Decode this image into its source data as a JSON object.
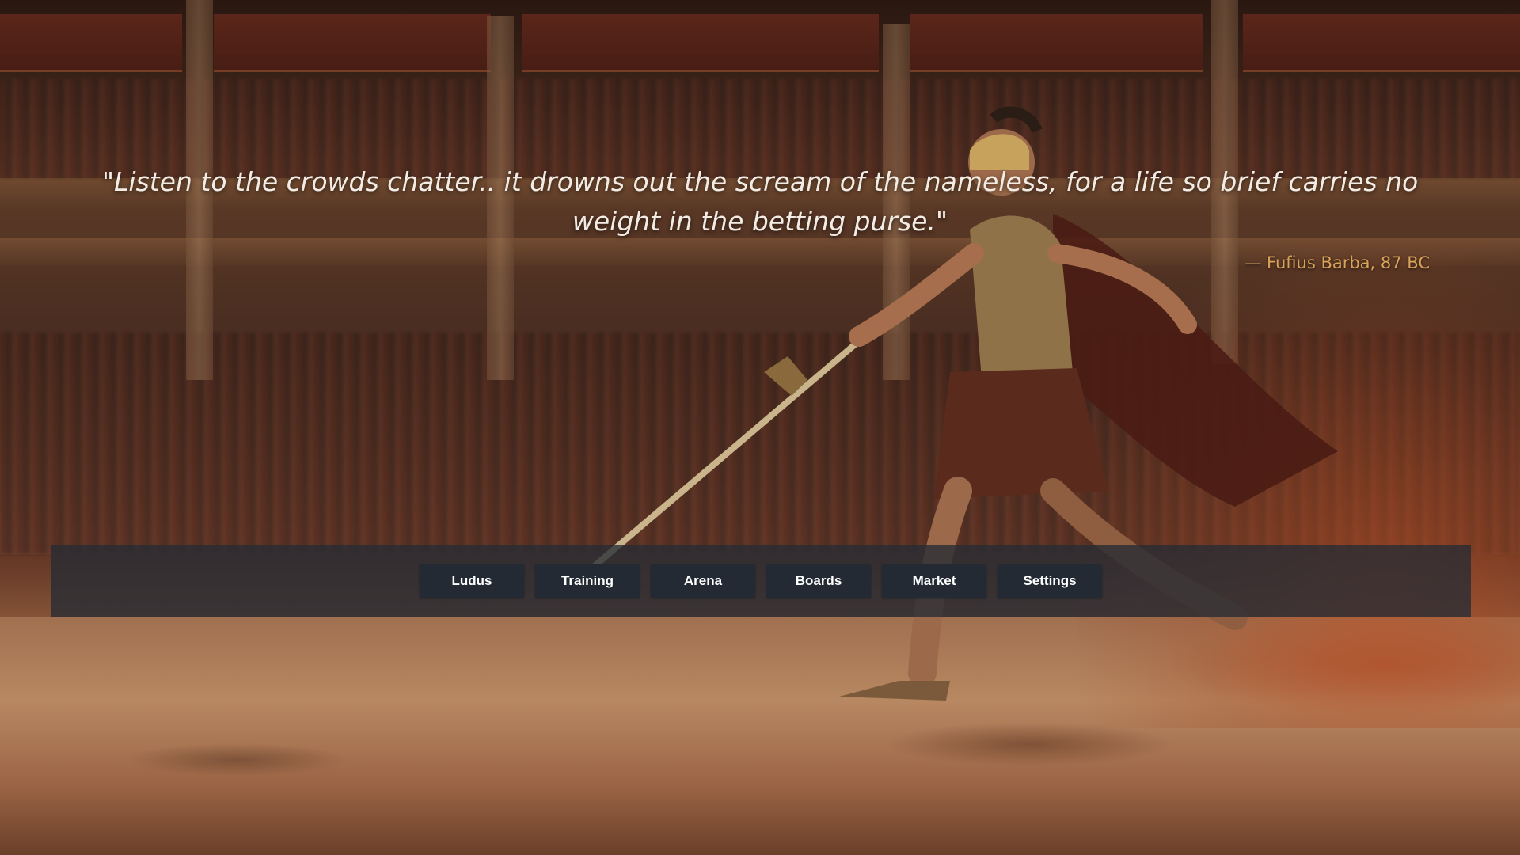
{
  "quote": {
    "text": "\"Listen to the crowds chatter.. it drowns out the scream of the nameless, for a life so brief carries no weight in the betting purse.\"",
    "attribution": "— Fufius Barba, 87 BC"
  },
  "nav": {
    "items": [
      {
        "label": "Ludus"
      },
      {
        "label": "Training"
      },
      {
        "label": "Arena"
      },
      {
        "label": "Boards"
      },
      {
        "label": "Market"
      },
      {
        "label": "Settings"
      }
    ]
  },
  "colors": {
    "quote_text": "#f3ece4",
    "attribution_text": "#d9a45a",
    "nav_bar_bg": "#262c34",
    "nav_button_bg": "#232a33",
    "nav_button_text": "#ffffff"
  }
}
